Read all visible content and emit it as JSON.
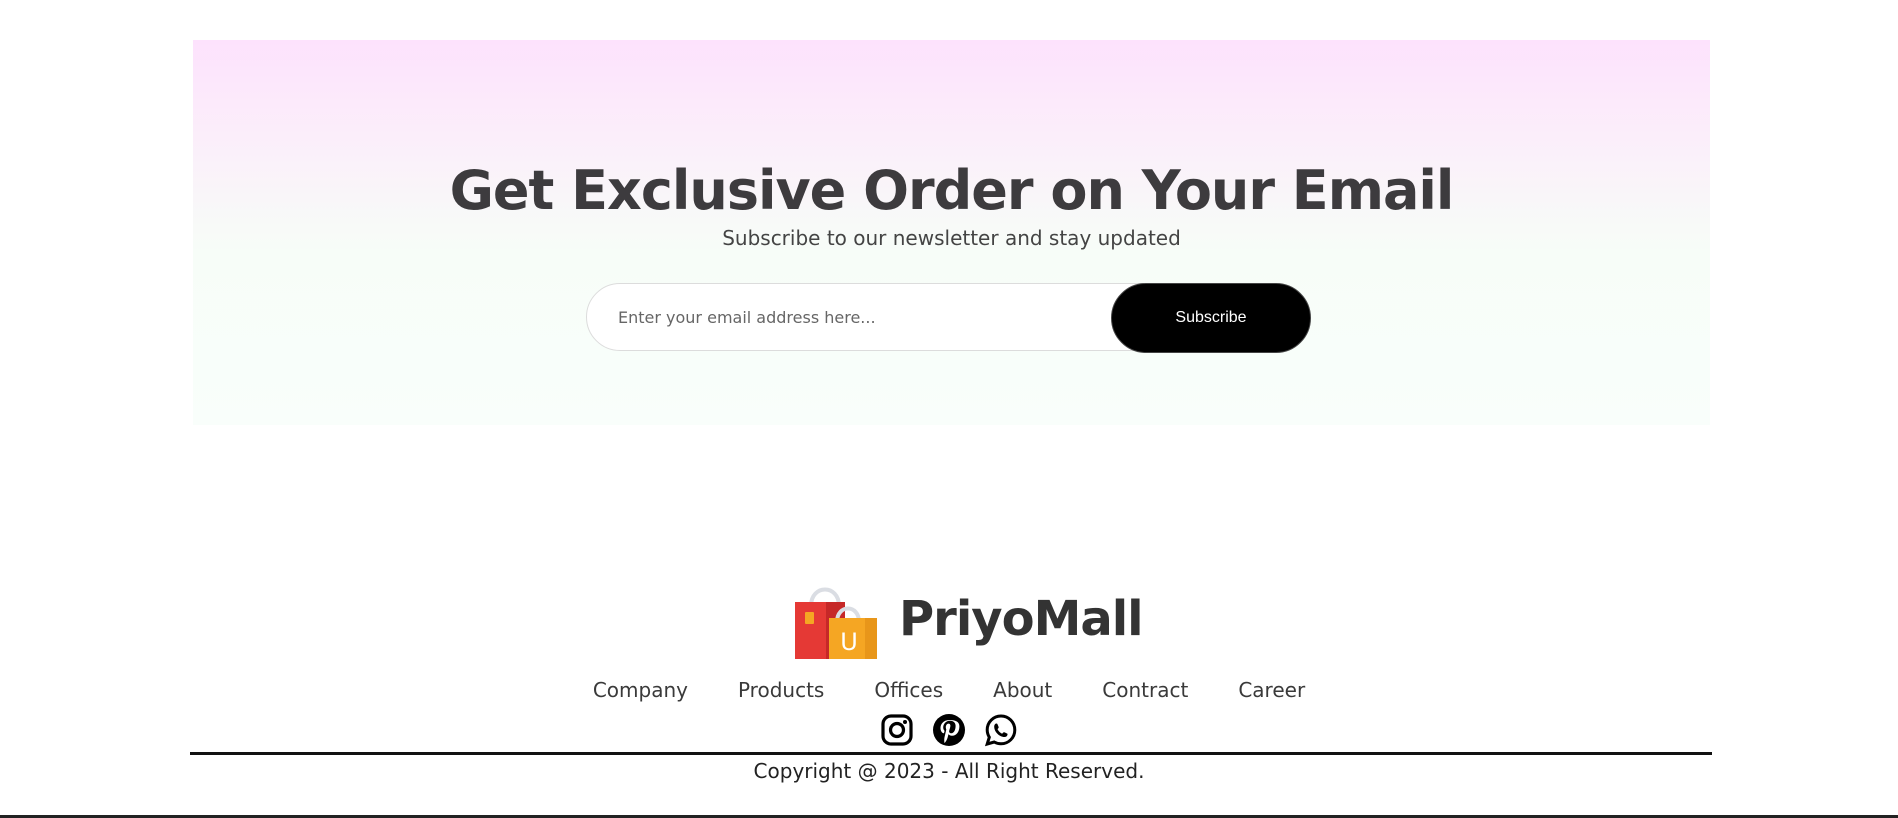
{
  "newsletter": {
    "title": "Get Exclusive Order on Your Email",
    "subtitle": "Subscribe to our newsletter and stay updated",
    "email_placeholder": "Enter your email address here...",
    "subscribe_label": "Subscribe"
  },
  "footer": {
    "brand_name": "PriyoMall",
    "logo_icon": "shopping-bags-icon",
    "logo_letter": "U",
    "nav": [
      {
        "label": "Company"
      },
      {
        "label": "Products"
      },
      {
        "label": "Offices"
      },
      {
        "label": "About"
      },
      {
        "label": "Contract"
      },
      {
        "label": "Career"
      }
    ],
    "social": [
      "instagram-icon",
      "pinterest-icon",
      "whatsapp-icon"
    ],
    "copyright": "Copyright @ 2023 - All Right Reserved."
  },
  "colors": {
    "button_bg": "#000000",
    "bag_red": "#e53935",
    "bag_yellow": "#f5a623"
  }
}
